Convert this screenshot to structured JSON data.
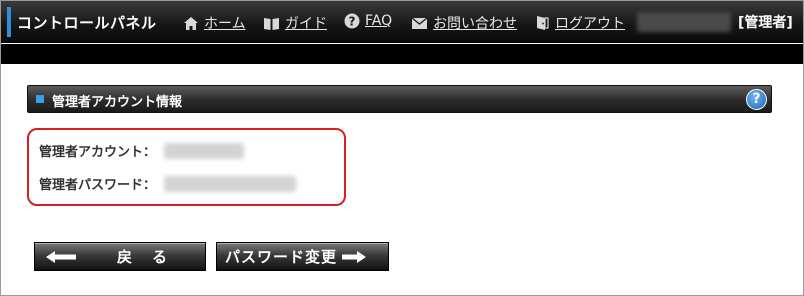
{
  "nav": {
    "brand": "コントロールパネル",
    "items": [
      {
        "icon": "home-icon",
        "label": "ホーム"
      },
      {
        "icon": "book-icon",
        "label": "ガイド"
      },
      {
        "icon": "question-icon",
        "label": "FAQ"
      },
      {
        "icon": "mail-icon",
        "label": "お問い合わせ"
      },
      {
        "icon": "logout-icon",
        "label": "ログアウト"
      }
    ],
    "role": "[管理者]"
  },
  "section": {
    "title": "管理者アカウント情報",
    "help_icon": "help-icon",
    "help_glyph": "?"
  },
  "info": {
    "account_label": "管理者アカウント：",
    "password_label": "管理者パスワード："
  },
  "buttons": {
    "back_label": "戻る",
    "change_password_label": "パスワード変更"
  },
  "colors": {
    "accent": "#2f8fd8",
    "highlight_border": "#d81e1e"
  }
}
